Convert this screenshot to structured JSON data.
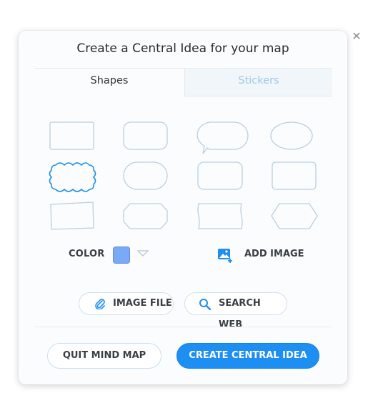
{
  "close_icon": "close-icon",
  "dialog": {
    "title": "Create a Central Idea for your map"
  },
  "tabs": [
    {
      "label": "Shapes",
      "active": true
    },
    {
      "label": "Stickers",
      "active": false
    }
  ],
  "shapes": {
    "selected_index": 4,
    "items": [
      "rectangle",
      "rounded-rectangle",
      "speech-bubble",
      "ellipse",
      "cloud",
      "stadium",
      "rounded-rectangle-soft",
      "rounded-rectangle-wide",
      "skewed-rectangle",
      "octagon-pill",
      "wavy-rectangle",
      "hexagon"
    ]
  },
  "color": {
    "label": "COLOR",
    "value": "#7aa9f5",
    "caret_icon": "chevron-down-icon"
  },
  "add_image": {
    "label": "ADD IMAGE",
    "icon": "add-image-icon"
  },
  "image_sources": {
    "image_file": {
      "label": "IMAGE FILE",
      "icon": "paperclip-icon"
    },
    "search_web": {
      "label": "SEARCH WEB",
      "icon": "search-icon"
    }
  },
  "footer": {
    "quit_label": "QUIT MIND MAP",
    "create_label": "CREATE CENTRAL IDEA"
  },
  "colors": {
    "accent": "#1d8ef2",
    "shape_stroke": "#b9cfe1",
    "shape_selected_stroke": "#1e90ee"
  }
}
